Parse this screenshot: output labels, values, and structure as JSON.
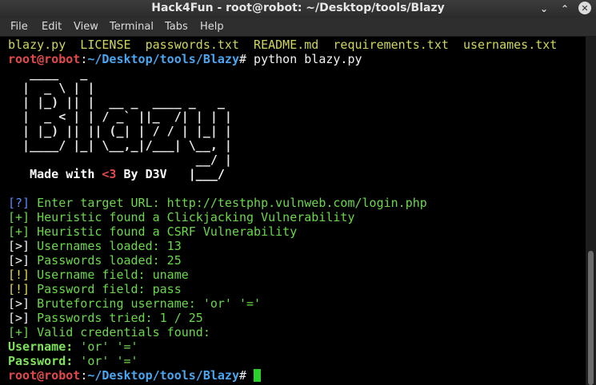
{
  "window": {
    "title": "Hack4Fun - root@robot: ~/Desktop/tools/Blazy"
  },
  "menu": [
    "File",
    "Edit",
    "View",
    "Terminal",
    "Tabs",
    "Help"
  ],
  "terminal": {
    "ls_output": "blazy.py  LICENSE  passwords.txt  README.md  requirements.txt  usernames.txt",
    "prompt1": {
      "user_host": "root@robot",
      "sep": ":",
      "path": "~/Desktop/tools/Blazy",
      "symbol": "#",
      "command": " python blazy.py"
    },
    "banner": [
      "   ____   _",
      "  |  _ \\ | |",
      "  | |_) || |  __ _  ____ _   _",
      "  |  _ < | | / _` ||_  /| | | |",
      "  | |_) || || (_| | / / | |_| |",
      "  |____/ |_| \\__,_|/___| \\__, |",
      "                          __/ |"
    ],
    "banner_last_left": "   Made with ",
    "banner_heart": "<3",
    "banner_last_right": " By D3V   |___/",
    "output": [
      {
        "tag": "[?]",
        "tag_color": "blue",
        "text": " Enter target URL: http://testphp.vulnweb.com/login.php",
        "text_color": "green"
      },
      {
        "tag": "[+]",
        "tag_color": "green",
        "text": " Heuristic found a Clickjacking Vulnerability",
        "text_color": "green"
      },
      {
        "tag": "[+]",
        "tag_color": "green",
        "text": " Heuristic found a CSRF Vulnerability",
        "text_color": "green"
      },
      {
        "tag": "[>]",
        "tag_color": "white",
        "text": " Usernames loaded: 13",
        "text_color": "green"
      },
      {
        "tag": "[>]",
        "tag_color": "white",
        "text": " Passwords loaded: 25",
        "text_color": "green"
      },
      {
        "tag": "[!]",
        "tag_color": "yellow",
        "text": " Username field: uname",
        "text_color": "green"
      },
      {
        "tag": "[!]",
        "tag_color": "yellow",
        "text": " Password field: pass",
        "text_color": "green"
      },
      {
        "tag": "[>]",
        "tag_color": "white",
        "text": " Bruteforcing username: 'or' '='",
        "text_color": "green"
      },
      {
        "tag": "[>]",
        "tag_color": "white",
        "text": " Passwords tried: 1 / 25",
        "text_color": "green"
      },
      {
        "tag": "[+]",
        "tag_color": "green",
        "text": " Valid credentials found:",
        "text_color": "green"
      }
    ],
    "username_label": "Username:",
    "username_value": " 'or' '='",
    "password_label": "Password:",
    "password_value": " 'or' '='",
    "prompt2": {
      "user_host": "root@robot",
      "sep": ":",
      "path": "~/Desktop/tools/Blazy",
      "symbol": "#",
      "command": " "
    }
  }
}
